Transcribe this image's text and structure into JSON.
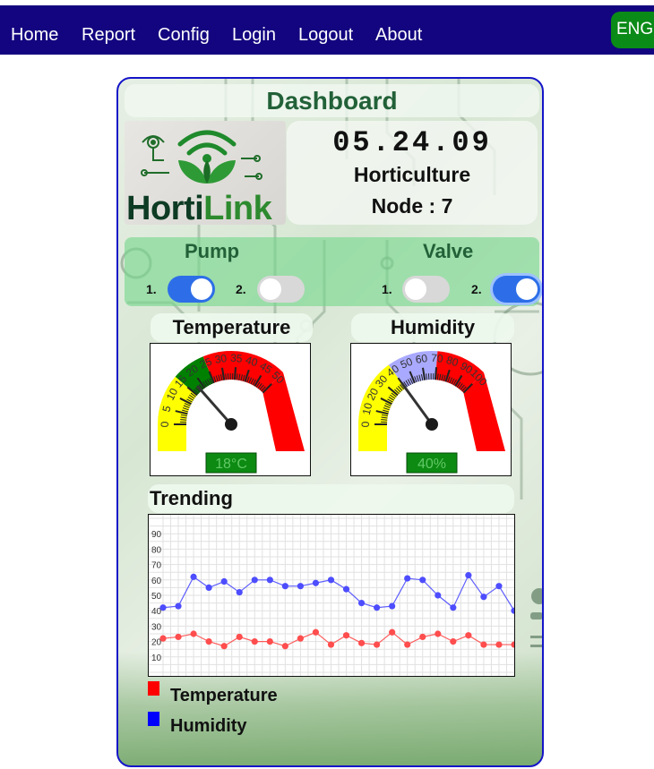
{
  "nav": {
    "items": [
      "Home",
      "Report",
      "Config",
      "Login",
      "Logout",
      "About"
    ],
    "language": "ENG"
  },
  "dashboard": {
    "title": "Dashboard",
    "logo": {
      "text_main": "Horti",
      "text_accent": "Link"
    },
    "clock": "05.24.09",
    "node_name": "Horticulture",
    "node_id": "Node : 7"
  },
  "controls": {
    "pump": {
      "label": "Pump",
      "switches": [
        {
          "num": "1.",
          "on": true
        },
        {
          "num": "2.",
          "on": false
        }
      ]
    },
    "valve": {
      "label": "Valve",
      "switches": [
        {
          "num": "1.",
          "on": false
        },
        {
          "num": "2.",
          "on": true
        }
      ]
    }
  },
  "gauges": {
    "temperature": {
      "label": "Temperature",
      "readout": "18°C",
      "value": 18,
      "min": 0,
      "max": 50,
      "ticks": [
        "0",
        "5",
        "10",
        "15",
        "20",
        "25",
        "30",
        "35",
        "40",
        "45",
        "50"
      ],
      "bands": [
        {
          "from": 0,
          "to": 15,
          "color": "#ffff00"
        },
        {
          "from": 15,
          "to": 25,
          "color": "#008000"
        },
        {
          "from": 25,
          "to": 50,
          "color": "#ff0000"
        }
      ]
    },
    "humidity": {
      "label": "Humidity",
      "readout": "40%",
      "value": 40,
      "min": 0,
      "max": 100,
      "ticks": [
        "0",
        "10",
        "20",
        "30",
        "40",
        "50",
        "60",
        "70",
        "80",
        "90",
        "100"
      ],
      "bands": [
        {
          "from": 0,
          "to": 40,
          "color": "#ffff00"
        },
        {
          "from": 40,
          "to": 70,
          "color": "#a9a9ff"
        },
        {
          "from": 70,
          "to": 100,
          "color": "#ff0000"
        }
      ]
    }
  },
  "trending": {
    "label": "Trending",
    "legend": [
      {
        "label": "Temperature",
        "color": "#ff0000"
      },
      {
        "label": "Humidity",
        "color": "#0000ff"
      }
    ]
  },
  "chart_data": {
    "type": "line",
    "ylim": [
      0,
      100
    ],
    "yticks": [
      10,
      20,
      30,
      40,
      50,
      60,
      70,
      80,
      90
    ],
    "grid": true,
    "series": [
      {
        "name": "Temperature",
        "color": "#ff4d4d",
        "values": [
          22,
          23,
          25,
          20,
          17,
          23,
          20,
          20,
          17,
          22,
          26,
          18,
          24,
          19,
          18,
          26,
          18,
          23,
          25,
          20,
          24,
          18,
          18,
          18
        ]
      },
      {
        "name": "Humidity",
        "color": "#4d4dff",
        "values": [
          42,
          43,
          62,
          55,
          59,
          52,
          60,
          60,
          56,
          56,
          58,
          60,
          54,
          45,
          42,
          43,
          61,
          60,
          50,
          42,
          63,
          49,
          56,
          40
        ]
      }
    ]
  }
}
